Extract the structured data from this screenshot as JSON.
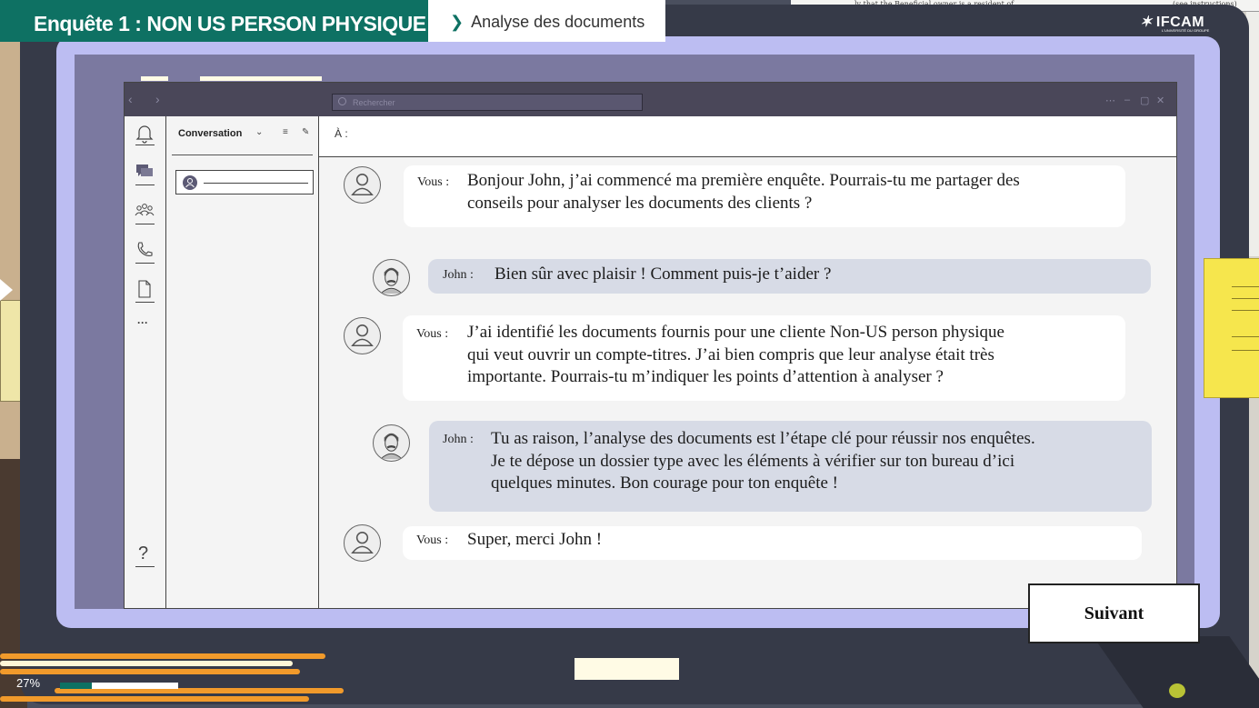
{
  "header": {
    "title": "Enquête 1 : NON US PERSON PHYSIQUE",
    "breadcrumb": "Analyse des documents",
    "logo": "IFCAM",
    "logo_tagline": "L'UNIVERSITÉ DU GROUPE"
  },
  "background": {
    "doc_text_left": "ly that the Beneficial owner is a resident of",
    "doc_text_right": "(see instructions)"
  },
  "app": {
    "search_placeholder": "Rechercher",
    "panel_title": "Conversation",
    "to_label": "À :",
    "help_label": "?",
    "more_label": "···"
  },
  "messages": [
    {
      "speaker": "Vous :",
      "text": "Bonjour John, j’ai commencé ma première enquête. Pourrais-tu me partager des\nconseils pour analyser les documents des clients ?"
    },
    {
      "speaker": "John :",
      "text": "Bien sûr avec plaisir ! Comment puis-je t’aider ?"
    },
    {
      "speaker": "Vous :",
      "text": "J’ai identifié les documents fournis pour une cliente Non-US person physique\nqui veut ouvrir un compte-titres. J’ai bien compris que leur analyse était très\nimportante. Pourrais-tu m’indiquer les points d’attention à analyser ?"
    },
    {
      "speaker": "John :",
      "text": "Tu as raison, l’analyse des documents est l’étape clé pour réussir nos enquêtes.\n Je te dépose un dossier type avec les éléments à vérifier sur ton bureau d’ici\nquelques minutes. Bon courage pour ton enquête !"
    },
    {
      "speaker": "Vous :",
      "text": "Super, merci John !"
    }
  ],
  "footer": {
    "next_label": "Suivant",
    "progress_label": "27%",
    "progress_value": 27
  },
  "colors": {
    "brand": "#0e7163",
    "screen": "#bcbdf2",
    "john_bubble": "#d7dbe6"
  }
}
